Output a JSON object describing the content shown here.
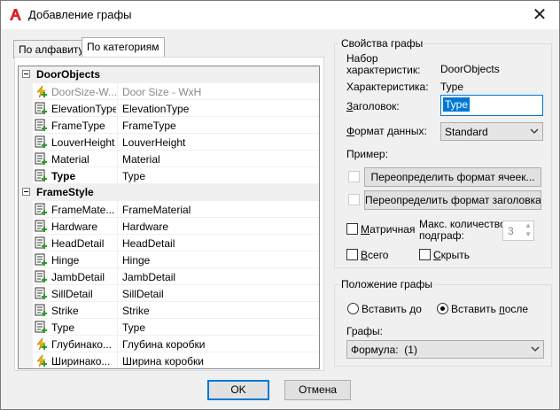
{
  "window": {
    "title": "Добавление графы",
    "close_symbol": "✕"
  },
  "tabs": [
    {
      "label": "По алфавиту",
      "active": false
    },
    {
      "label": "По категориям",
      "active": true
    }
  ],
  "grid": {
    "categories": [
      {
        "label": "DoorObjects",
        "rows": [
          {
            "name": "DoorSize-W...",
            "value": "Door Size - WxH",
            "icon": "formula-icon",
            "dim": true
          },
          {
            "name": "ElevationType",
            "value": "ElevationType",
            "icon": "property-icon"
          },
          {
            "name": "FrameType",
            "value": "FrameType",
            "icon": "property-icon"
          },
          {
            "name": "LouverHeight",
            "value": "LouverHeight",
            "icon": "property-icon"
          },
          {
            "name": "Material",
            "value": "Material",
            "icon": "property-icon"
          },
          {
            "name": "Type",
            "value": "Type",
            "icon": "property-icon",
            "bold": true
          }
        ]
      },
      {
        "label": "FrameStyle",
        "rows": [
          {
            "name": "FrameMate...",
            "value": "FrameMaterial",
            "icon": "property-icon"
          },
          {
            "name": "Hardware",
            "value": "Hardware",
            "icon": "property-icon"
          },
          {
            "name": "HeadDetail",
            "value": "HeadDetail",
            "icon": "property-icon"
          },
          {
            "name": "Hinge",
            "value": "Hinge",
            "icon": "property-icon"
          },
          {
            "name": "JambDetail",
            "value": "JambDetail",
            "icon": "property-icon"
          },
          {
            "name": "SillDetail",
            "value": "SillDetail",
            "icon": "property-icon"
          },
          {
            "name": "Strike",
            "value": "Strike",
            "icon": "property-icon"
          },
          {
            "name": "Type",
            "value": "Type",
            "icon": "property-icon"
          },
          {
            "name": "Глубинако...",
            "value": "Глубина коробки",
            "icon": "formula-icon"
          },
          {
            "name": "Ширинако...",
            "value": "Ширина коробки",
            "icon": "formula-icon"
          }
        ]
      }
    ]
  },
  "column_props": {
    "group_title": "Свойства графы",
    "set_label": "Набор характеристик:",
    "set_line1": "Набор",
    "set_line2": "характеристик:",
    "set_value": "DoorObjects",
    "property_label": "Характеристика:",
    "property_value": "Type",
    "heading_label": "Заголовок:",
    "heading_value": "Type",
    "data_format_label": "Формат данных:",
    "data_format_value": "Standard",
    "example_label": "Пример:",
    "override_cell_format": "Переопределить формат ячеек...",
    "override_header_format": "Переопределить формат заголовка...",
    "matrix_label": "Матричная",
    "max_subcols_label_line1": "Макс. количество",
    "max_subcols_label_line2": "подграф:",
    "max_subcols_value": "3",
    "total_label": "Всего",
    "hide_label": "Скрыть"
  },
  "column_position": {
    "group_title": "Положение графы",
    "insert_before": "Вставить до",
    "insert_after": "Вставить после",
    "insert_after_selected": true,
    "column_label": "Графы:",
    "column_value": "Формула:  (1)"
  },
  "footer": {
    "ok": "OK",
    "cancel": "Отмена"
  },
  "colors": {
    "accent": "#0078d7",
    "autocad_red": "#e02020",
    "formula_yellow": "#f5b400",
    "plus_green": "#2a9d2a"
  }
}
